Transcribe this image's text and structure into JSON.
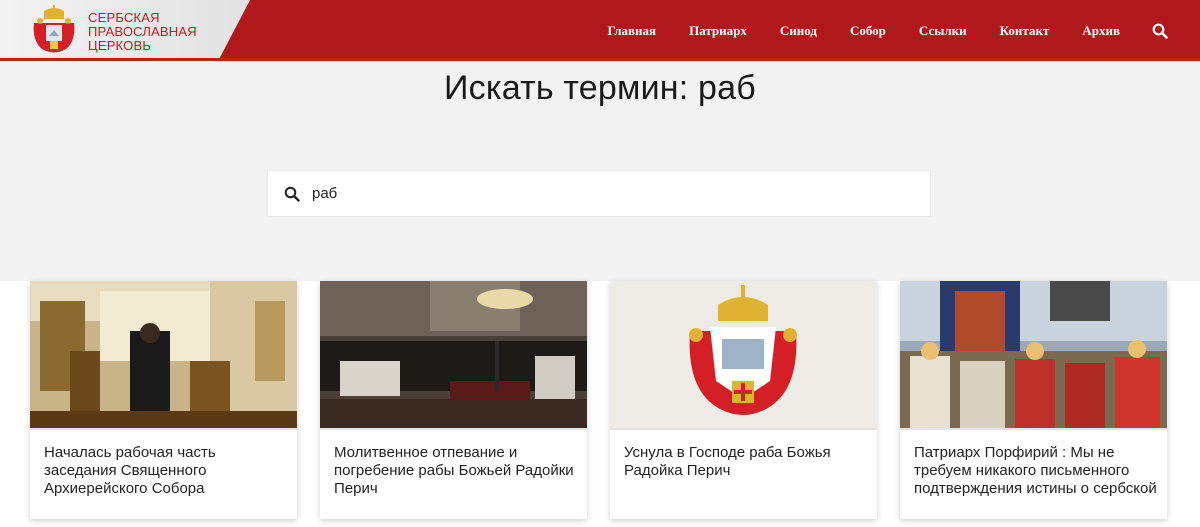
{
  "logo": {
    "line1": "СЕРБСКАЯ",
    "line2": "ПРАВОСЛАВНАЯ",
    "line3": "ЦЕРКОВЬ"
  },
  "nav": {
    "items": [
      {
        "label": "Главная"
      },
      {
        "label": "Патриарх"
      },
      {
        "label": "Синод"
      },
      {
        "label": "Собор"
      },
      {
        "label": "Ссылки"
      },
      {
        "label": "Контакт"
      },
      {
        "label": "Архив"
      }
    ],
    "search_icon": "search-icon"
  },
  "page": {
    "title": "Искать термин: раб"
  },
  "search": {
    "value": "раб",
    "icon": "search-icon"
  },
  "cards": [
    {
      "title": "Началась рабочая часть заседания Священного Архиерейского Собора",
      "image": "church-interior-photo"
    },
    {
      "title": "Молитвенное отпевание и погребение рабы Божьей Радойки Перич",
      "image": "funeral-service-photo"
    },
    {
      "title": "Уснула в Господе раба Божья Радойка Перич",
      "image": "coat-of-arms-emblem"
    },
    {
      "title": "Патриарх Порфирий : Мы не требуем никакого письменного подтверждения истины о сербской",
      "image": "outdoor-liturgy-photo"
    }
  ],
  "colors": {
    "header_red": "#b0181c",
    "logo_red": "#c8191e",
    "hero_bg": "#f2f2f2"
  }
}
